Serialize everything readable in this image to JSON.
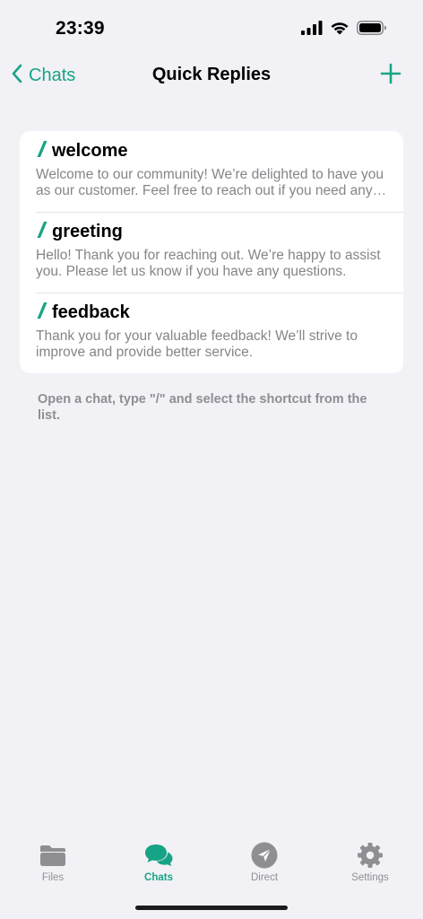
{
  "status_bar": {
    "time": "23:39",
    "icons": [
      "cellular-signal-icon",
      "wifi-icon",
      "battery-icon"
    ]
  },
  "nav": {
    "back_label": "Chats",
    "title": "Quick Replies",
    "add_icon": "plus-icon"
  },
  "replies": [
    {
      "shortcut": "welcome",
      "text": "Welcome to our community! We’re delighted to have you as our customer. Feel free to reach out if you need any help."
    },
    {
      "shortcut": "greeting",
      "text": "Hello! Thank you for reaching out. We’re happy to assist you. Please let us know if you have any questions."
    },
    {
      "shortcut": "feedback",
      "text": "Thank you for your valuable feedback! We’ll strive to improve and provide better service."
    }
  ],
  "hint": "Open a chat, type \"/\" and select the shortcut from the list.",
  "tabs": [
    {
      "label": "Files",
      "icon": "folder-icon",
      "active": false
    },
    {
      "label": "Chats",
      "icon": "chat-bubbles-icon",
      "active": true
    },
    {
      "label": "Direct",
      "icon": "paper-plane-icon",
      "active": false
    },
    {
      "label": "Settings",
      "icon": "gear-icon",
      "active": false
    }
  ],
  "colors": {
    "accent": "#17a486",
    "background": "#f2f1f6",
    "secondary_text": "#85858a",
    "inactive_tab": "#8e8e93"
  }
}
